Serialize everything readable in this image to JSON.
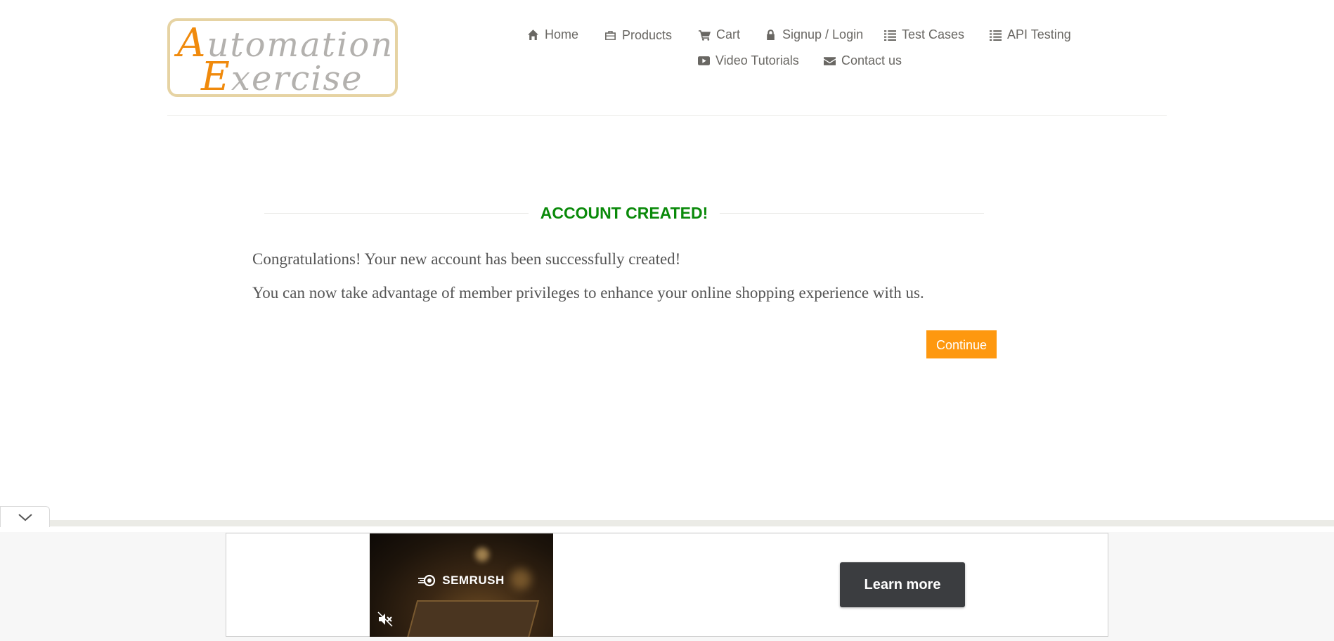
{
  "logo": {
    "line1_cap": "A",
    "line1_rest": "utomation",
    "line2_cap": "E",
    "line2_rest": "xercise"
  },
  "nav": {
    "home": "Home",
    "products": "Products",
    "cart": "Cart",
    "signup_login": "Signup / Login",
    "test_cases": "Test Cases",
    "api_testing": "API Testing",
    "video_tutorials": "Video Tutorials",
    "contact_us": "Contact us"
  },
  "main": {
    "title": "ACCOUNT CREATED!",
    "paragraph1": "Congratulations! Your new account has been successfully created!",
    "paragraph2": "You can now take advantage of member privileges to enhance your online shopping experience with us.",
    "continue_label": "Continue"
  },
  "ad": {
    "brand": "SEMRUSH",
    "learn_more_label": "Learn more"
  },
  "colors": {
    "title_green": "#0a8a0a",
    "button_orange": "#fe980f",
    "logo_orange": "#f08a0c",
    "text_gray": "#696763"
  }
}
